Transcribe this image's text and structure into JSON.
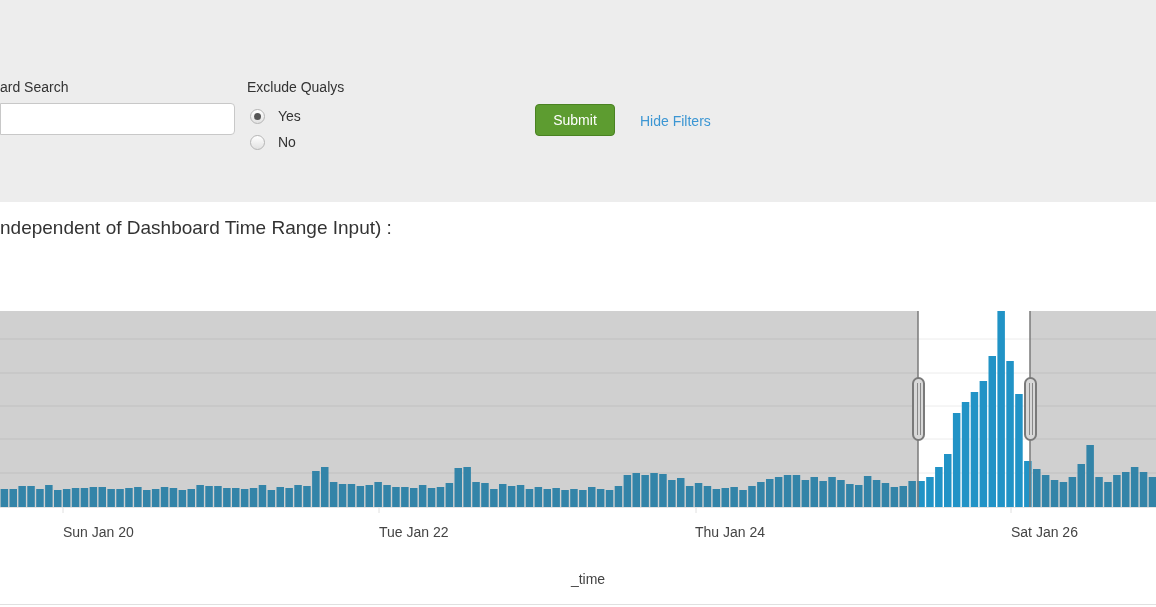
{
  "filters": {
    "keyword_search": {
      "label": "ard Search"
    },
    "exclude_qualys": {
      "label": "Exclude Qualys",
      "options": [
        {
          "label": "Yes",
          "selected": true
        },
        {
          "label": "No",
          "selected": false
        }
      ]
    },
    "submit": "Submit",
    "hide_filters": "Hide Filters"
  },
  "panel": {
    "title": "ndependent of Dashboard Time Range Input) :",
    "chart": {
      "x_tick_labels": [
        "Sun Jan 20",
        "Tue Jan 22",
        "Thu Jan 24",
        "Sat Jan 26"
      ],
      "x_axis_label": "_time"
    }
  }
}
